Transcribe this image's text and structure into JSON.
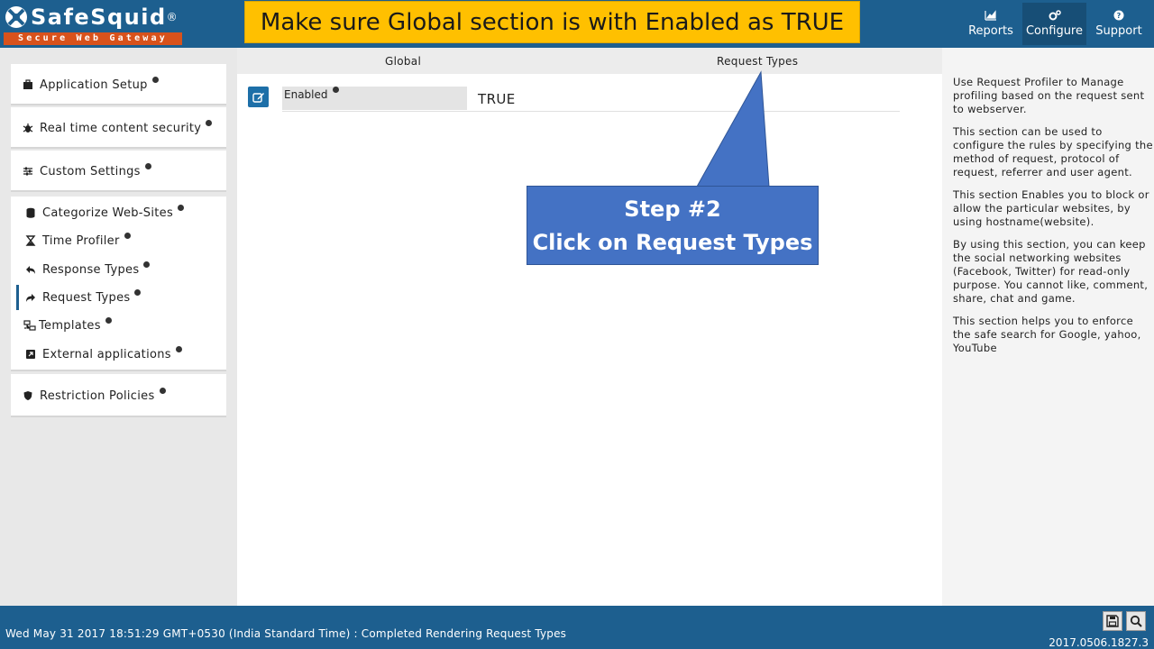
{
  "app": {
    "logo_text": "SafeSquid",
    "logo_reg": "®",
    "logo_tagline": "Secure Web Gateway"
  },
  "banner": "Make sure Global section is  with Enabled as TRUE",
  "nav": {
    "reports": "Reports",
    "configure": "Configure",
    "support": "Support"
  },
  "sidebar": {
    "groups": [
      {
        "label": "Application Setup",
        "icon": "briefcase-icon"
      },
      {
        "label": "Real time content security",
        "icon": "bug-icon"
      },
      {
        "label": "Custom Settings",
        "icon": "sliders-icon"
      }
    ],
    "items": [
      {
        "label": "Categorize Web-Sites",
        "icon": "database-icon"
      },
      {
        "label": "Time Profiler",
        "icon": "hourglass-icon"
      },
      {
        "label": "Response Types",
        "icon": "reply-icon"
      },
      {
        "label": "Request Types",
        "icon": "share-icon"
      },
      {
        "label": "Templates",
        "icon": "sitemap-icon"
      },
      {
        "label": "External applications",
        "icon": "external-icon"
      }
    ],
    "restriction": {
      "label": "Restriction Policies",
      "icon": "shield-icon"
    }
  },
  "main": {
    "tabs": [
      "Global",
      "Request Types"
    ],
    "field": {
      "label": "Enabled",
      "value": "TRUE"
    }
  },
  "callout": {
    "line1": "Step #2",
    "line2": "Click on Request Types"
  },
  "help": [
    "Use Request Profiler to Manage profiling based on the request sent to webserver.",
    "This section can be used to configure the rules by specifying the method of request, protocol of request, referrer and user agent.",
    "This section Enables you to block or allow the particular websites, by using hostname(website).",
    "By using this section, you can keep the social networking websites (Facebook, Twitter) for read-only purpose. You cannot like, comment, share, chat and game.",
    "This section helps you to enforce the safe search for Google, yahoo, YouTube"
  ],
  "footer": {
    "status": "Wed May 31 2017 18:51:29 GMT+0530 (India Standard Time) : Completed Rendering Request Types",
    "version": "2017.0506.1827.3"
  },
  "colors": {
    "header": "#1d5f8f",
    "banner": "#ffc000",
    "callout": "#4472c4",
    "logo_tag": "#d8521c"
  }
}
